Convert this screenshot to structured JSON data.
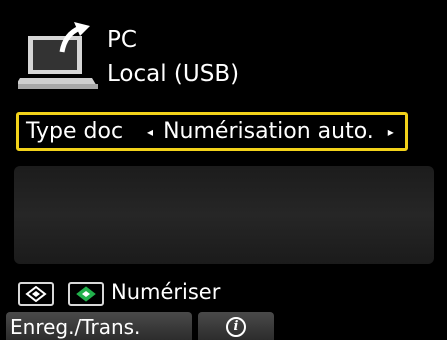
{
  "destination": {
    "name": "PC",
    "connection": "Local (USB)",
    "icon": "laptop-computer-icon"
  },
  "setting": {
    "label": "Type doc",
    "value": "Numérisation auto.",
    "left_arrow": "◂",
    "right_arrow": "▸",
    "highlight_color": "#f2d21a"
  },
  "actions": {
    "start_mono_icon": "black-start-icon",
    "start_color_icon": "color-start-icon",
    "start_color_accent": "#22b14c",
    "scan_label": "Numériser"
  },
  "function_buttons": {
    "save_label": "Enreg./Trans.",
    "info_label": "i",
    "info_icon": "info-icon"
  }
}
